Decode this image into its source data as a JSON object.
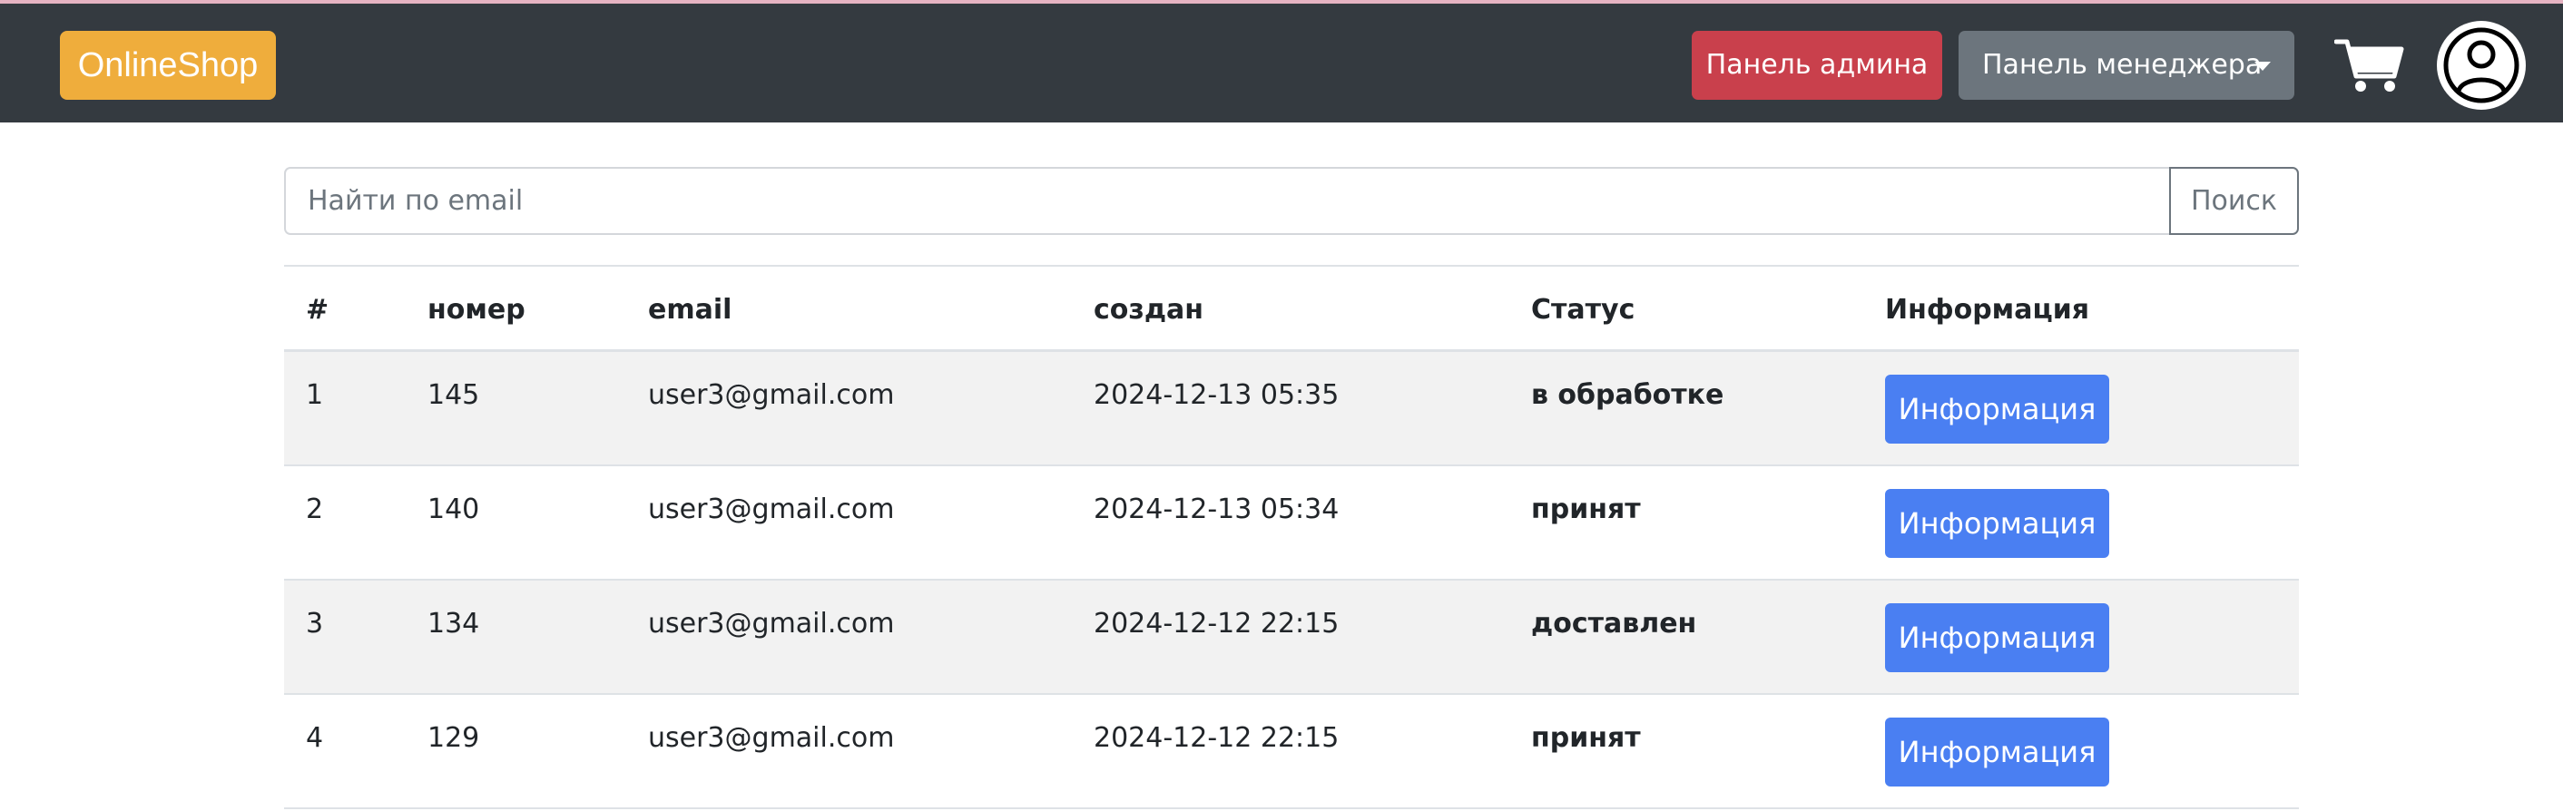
{
  "navbar": {
    "brand": "OnlineShop",
    "admin_panel_label": "Панель админа",
    "manager_panel_label": "Панель менеджера",
    "cart_icon": "cart-icon",
    "profile_icon": "user-circle-icon"
  },
  "search": {
    "placeholder": "Найти по email",
    "value": "",
    "button_label": "Поиск"
  },
  "table": {
    "headers": [
      "#",
      "номер",
      "email",
      "создан",
      "Статус",
      "Информация"
    ],
    "rows": [
      {
        "index": "1",
        "number": "145",
        "email": "user3@gmail.com",
        "created": "2024-12-13 05:35",
        "status": "в обработке",
        "info_label": "Информация"
      },
      {
        "index": "2",
        "number": "140",
        "email": "user3@gmail.com",
        "created": "2024-12-13 05:34",
        "status": "принят",
        "info_label": "Информация"
      },
      {
        "index": "3",
        "number": "134",
        "email": "user3@gmail.com",
        "created": "2024-12-12 22:15",
        "status": "доставлен",
        "info_label": "Информация"
      },
      {
        "index": "4",
        "number": "129",
        "email": "user3@gmail.com",
        "created": "2024-12-12 22:15",
        "status": "принят",
        "info_label": "Информация"
      }
    ]
  },
  "colors": {
    "navbar_bg": "#343a40",
    "brand_bg": "#efad3c",
    "admin_button": "#c9404c",
    "manager_button": "#6c757d",
    "info_button": "#4a7ff2",
    "striped_row": "#f2f2f2"
  }
}
